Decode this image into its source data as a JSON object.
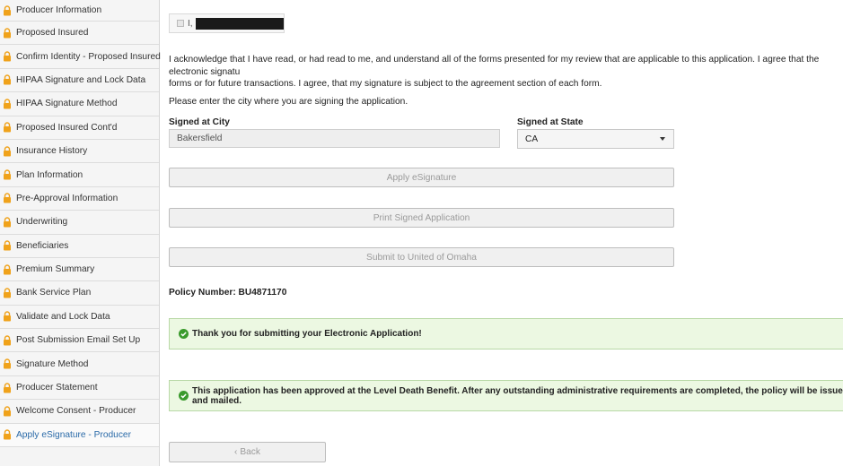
{
  "sidebar": {
    "items": [
      {
        "label": "Producer Information",
        "icon": "lock-icon"
      },
      {
        "label": "Proposed Insured",
        "icon": "lock-icon"
      },
      {
        "label": "Confirm Identity - Proposed Insured",
        "icon": "lock-icon"
      },
      {
        "label": "HIPAA Signature and Lock Data",
        "icon": "lock-icon"
      },
      {
        "label": "HIPAA Signature Method",
        "icon": "lock-icon"
      },
      {
        "label": "Proposed Insured Cont'd",
        "icon": "lock-icon"
      },
      {
        "label": "Insurance History",
        "icon": "lock-icon"
      },
      {
        "label": "Plan Information",
        "icon": "lock-icon"
      },
      {
        "label": "Pre-Approval Information",
        "icon": "lock-icon"
      },
      {
        "label": "Underwriting",
        "icon": "lock-icon"
      },
      {
        "label": "Beneficiaries",
        "icon": "lock-icon"
      },
      {
        "label": "Premium Summary",
        "icon": "lock-icon"
      },
      {
        "label": "Bank Service Plan",
        "icon": "lock-icon"
      },
      {
        "label": "Validate and Lock Data",
        "icon": "lock-icon"
      },
      {
        "label": "Post Submission Email Set Up",
        "icon": "lock-icon"
      },
      {
        "label": "Signature Method",
        "icon": "lock-icon"
      },
      {
        "label": "Producer Statement",
        "icon": "lock-icon"
      },
      {
        "label": "Welcome Consent - Producer",
        "icon": "lock-icon"
      },
      {
        "label": "Apply eSignature - Producer",
        "icon": "lock-icon",
        "active": true
      }
    ]
  },
  "ack": {
    "prefix": "I,"
  },
  "acknowledgement": "I acknowledge that I have read, or had read to me, and understand all of the forms presented for my review that are applicable to this application. I agree that the electronic signatu\nforms or for future transactions. I agree, that my signature is subject to the agreement section of each form.",
  "city_prompt": "Please enter the city where you are signing the application.",
  "fields": {
    "city_label": "Signed at City",
    "city_value": "Bakersfield",
    "state_label": "Signed at State",
    "state_value": "CA"
  },
  "buttons": {
    "apply": "Apply eSignature",
    "print": "Print Signed Application",
    "submit": "Submit to United of Omaha",
    "back": "Back"
  },
  "policy": {
    "text": "Policy Number: BU4871170"
  },
  "alerts": {
    "submitted": "Thank you for submitting your Electronic Application!",
    "approved": "This application has been approved at the Level Death Benefit. After any outstanding administrative requirements are completed, the policy will be issued and mailed."
  },
  "colors": {
    "lock": "#f0a21a",
    "success": "#3a9a2c",
    "active_link": "#2a6aa8"
  }
}
